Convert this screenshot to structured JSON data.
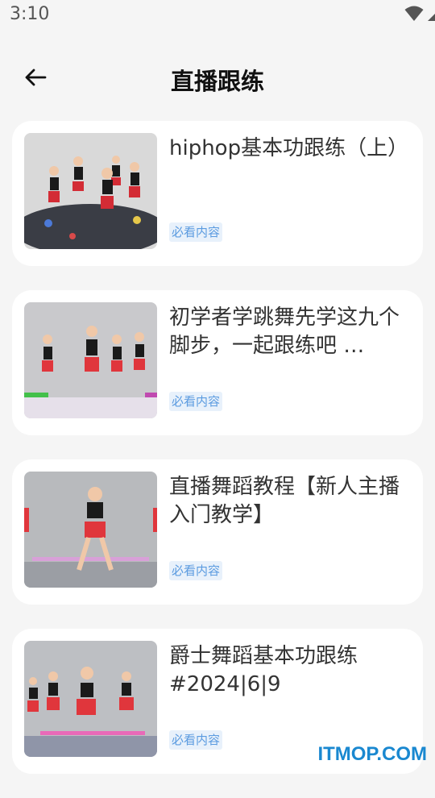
{
  "status_bar": {
    "time": "3:10",
    "icons": [
      "wifi-icon",
      "cellular-signal-icon",
      "battery-charging-icon"
    ]
  },
  "header": {
    "title": "直播跟练",
    "back_icon": "arrow-left-icon"
  },
  "videos": [
    {
      "title": "hiphop基本功跟练（上）",
      "tag": "必看内容"
    },
    {
      "title": "初学者学跳舞先学这九个脚步，一起跟练吧 …",
      "tag": "必看内容"
    },
    {
      "title": "直播舞蹈教程【新人主播入门教学】",
      "tag": "必看内容"
    },
    {
      "title": "爵士舞蹈基本功跟练#2024|6|9",
      "tag": "必看内容"
    }
  ],
  "watermark": "ITMOP.COM",
  "colors": {
    "background": "#f5f5f5",
    "card": "#ffffff",
    "tag_bg": "#e8f1fb",
    "tag_text": "#5b9be0",
    "watermark": "#1a88d0"
  }
}
